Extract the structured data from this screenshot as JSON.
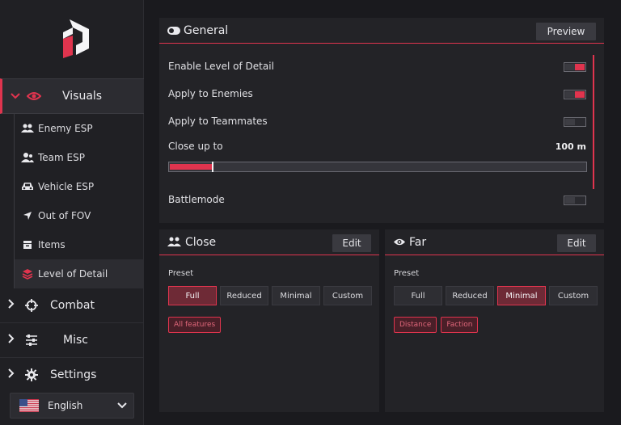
{
  "sidebar": {
    "visuals_label": "Visuals",
    "sub_items": [
      {
        "label": "Enemy ESP",
        "icon": "users-icon"
      },
      {
        "label": "Team ESP",
        "icon": "user-group-icon"
      },
      {
        "label": "Vehicle ESP",
        "icon": "car-icon"
      },
      {
        "label": "Out of FOV",
        "icon": "location-arrow-icon"
      },
      {
        "label": "Items",
        "icon": "box-icon"
      },
      {
        "label": "Level of Detail",
        "icon": "layers-icon"
      }
    ],
    "combat_label": "Combat",
    "misc_label": "Misc",
    "settings_label": "Settings",
    "language": "English"
  },
  "general": {
    "title": "General",
    "preview_label": "Preview",
    "rows": {
      "enable_lod": {
        "label": "Enable Level of Detail",
        "on": true
      },
      "apply_enemies": {
        "label": "Apply to Enemies",
        "on": true
      },
      "apply_teammates": {
        "label": "Apply to Teammates",
        "on": false
      },
      "close_up_to": {
        "label": "Close up to",
        "value": "100 m",
        "fraction": 0.1
      },
      "battlemode": {
        "label": "Battlemode",
        "on": false
      }
    }
  },
  "close_panel": {
    "title": "Close",
    "edit_label": "Edit",
    "preset_label": "Preset",
    "presets": [
      "Full",
      "Reduced",
      "Minimal",
      "Custom"
    ],
    "selected": "Full",
    "tags": [
      "All features"
    ]
  },
  "far_panel": {
    "title": "Far",
    "edit_label": "Edit",
    "preset_label": "Preset",
    "presets": [
      "Full",
      "Reduced",
      "Minimal",
      "Custom"
    ],
    "selected": "Minimal",
    "tags": [
      "Distance",
      "Faction"
    ]
  },
  "colors": {
    "accent": "#e0344e",
    "background": "#1a1a1e",
    "panel": "#232327"
  }
}
